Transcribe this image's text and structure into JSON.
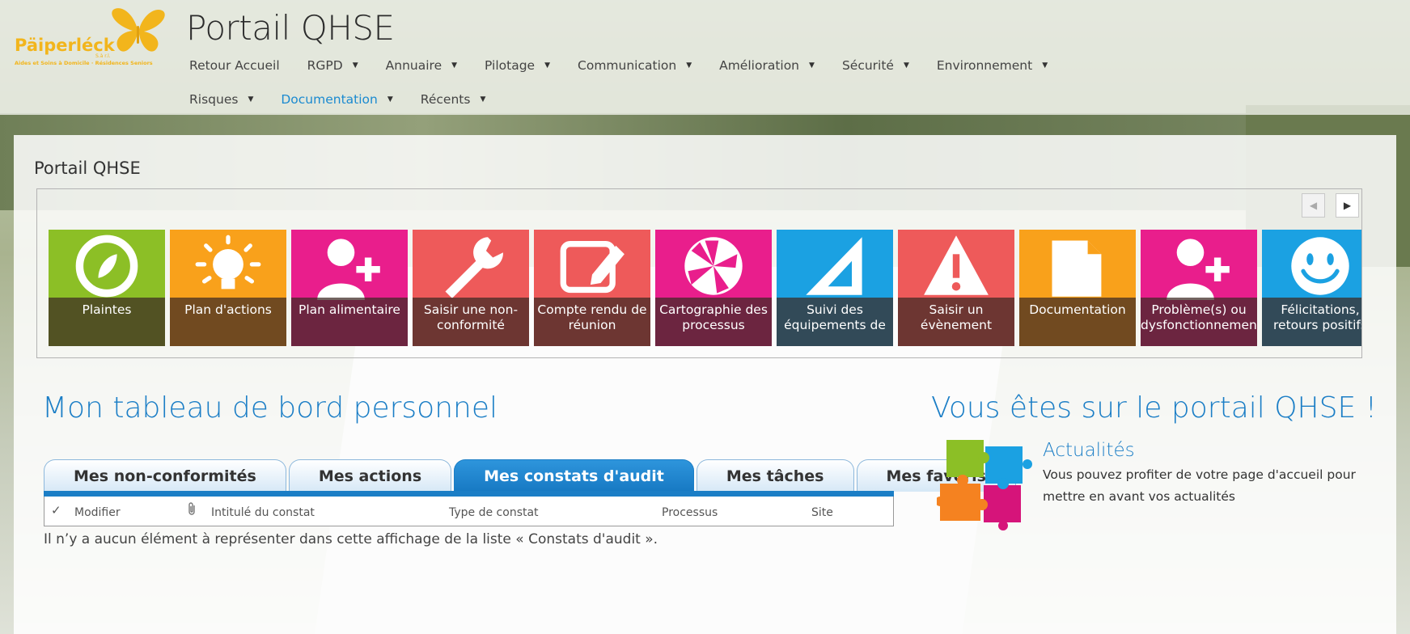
{
  "logo": {
    "name": "Päiperléck",
    "suffix": "S.à r.l.",
    "tagline": "Aides et Soins à Domicile · Résidences Seniors"
  },
  "site_title": "Portail QHSE",
  "nav": {
    "row1": [
      {
        "label": "Retour Accueil",
        "caret": false
      },
      {
        "label": "RGPD",
        "caret": true
      },
      {
        "label": "Annuaire",
        "caret": true
      },
      {
        "label": "Pilotage",
        "caret": true
      },
      {
        "label": "Communication",
        "caret": true
      },
      {
        "label": "Amélioration",
        "caret": true
      },
      {
        "label": "Sécurité",
        "caret": true
      },
      {
        "label": "Environnement",
        "caret": true
      }
    ],
    "row2": [
      {
        "label": "Risques",
        "caret": true
      },
      {
        "label": "Documentation",
        "caret": true,
        "active": true
      },
      {
        "label": "Récents",
        "caret": true
      }
    ]
  },
  "panel_title": "Portail QHSE",
  "carousel": {
    "prev_icon": "chevron-left-icon",
    "next_icon": "chevron-right-icon",
    "tiles": [
      {
        "label": "Plaintes",
        "icon": "compass-leaf-icon",
        "color": "#8cbf26"
      },
      {
        "label": "Plan d'actions",
        "icon": "lightbulb-icon",
        "color": "#f9a11b"
      },
      {
        "label": "Plan alimentaire",
        "icon": "add-user-icon",
        "color": "#e91e8c"
      },
      {
        "label": "Saisir une non-conformité",
        "icon": "wrench-icon",
        "color": "#ee5a5a"
      },
      {
        "label": "Compte rendu de réunion",
        "icon": "edit-icon",
        "color": "#ee5a5a"
      },
      {
        "label": "Cartographie des processus",
        "icon": "aperture-icon",
        "color": "#e91e8c"
      },
      {
        "label": "Suivi des équipements de",
        "icon": "set-square-icon",
        "color": "#1ba1e2"
      },
      {
        "label": "Saisir un évènement",
        "icon": "warning-icon",
        "color": "#ee5a5a"
      },
      {
        "label": "Documentation",
        "icon": "document-icon",
        "color": "#f9a11b"
      },
      {
        "label": "Problème(s) ou dysfonctionnement",
        "icon": "add-user-icon",
        "color": "#e91e8c"
      },
      {
        "label": "Félicitations, retours positifs",
        "icon": "smiley-icon",
        "color": "#1ba1e2"
      }
    ]
  },
  "dashboard": {
    "title": "Mon tableau de bord personnel",
    "tabs": [
      {
        "label": "Mes non-conformités"
      },
      {
        "label": "Mes actions"
      },
      {
        "label": "Mes constats d'audit",
        "active": true
      },
      {
        "label": "Mes tâches"
      },
      {
        "label": "Mes favoris"
      }
    ],
    "columns": [
      "Modifier",
      "Intitulé du constat",
      "Type de constat",
      "Processus",
      "Site"
    ],
    "empty_message": "Il n’y a aucun élément à représenter dans cette affichage de la liste « Constats d'audit »."
  },
  "news": {
    "heading": "Vous êtes sur le portail QHSE !",
    "title": "Actualités",
    "text": "Vous pouvez profiter de votre page d'accueil pour mettre en avant vos actualités"
  },
  "colors": {
    "accent": "#1b7ec6",
    "logo": "#f2b51c"
  }
}
